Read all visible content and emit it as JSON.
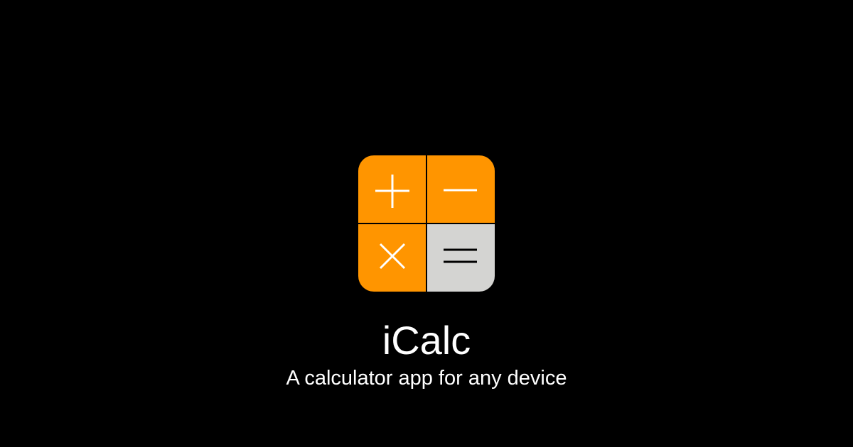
{
  "app": {
    "name": "iCalc",
    "tagline": "A calculator app for any device"
  },
  "icon": {
    "tiles": [
      {
        "symbol": "plus-icon",
        "color": "#ff9500",
        "glyph_color": "#ffffff"
      },
      {
        "symbol": "minus-icon",
        "color": "#ff9500",
        "glyph_color": "#ffffff"
      },
      {
        "symbol": "multiply-icon",
        "color": "#ff9500",
        "glyph_color": "#ffffff"
      },
      {
        "symbol": "equals-icon",
        "color": "#d4d4d2",
        "glyph_color": "#000000"
      }
    ]
  },
  "colors": {
    "background": "#000000",
    "text": "#ffffff"
  }
}
